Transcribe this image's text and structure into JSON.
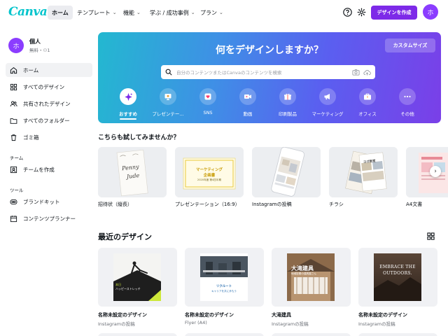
{
  "topnav": {
    "logo": "Canva",
    "items": [
      {
        "label": "ホーム",
        "active": true
      },
      {
        "label": "テンプレート",
        "chevron": "⌄"
      },
      {
        "label": "機能",
        "chevron": "⌄"
      },
      {
        "label": "学ぶ / 成功事例",
        "chevron": "⌄"
      },
      {
        "label": "プラン",
        "chevron": "⌄"
      }
    ],
    "help_icon": "help-circle-icon",
    "settings_icon": "gear-icon",
    "create_button": "デザインを作成",
    "avatar_initial": "ホ"
  },
  "sidebar": {
    "user": {
      "initial": "ホ",
      "name": "個人",
      "plan": "無料・",
      "members": "1"
    },
    "items": [
      {
        "label": "ホーム",
        "icon": "home-icon",
        "active": true
      },
      {
        "label": "すべてのデザイン",
        "icon": "grid-icon"
      },
      {
        "label": "共有されたデザイン",
        "icon": "people-icon"
      },
      {
        "label": "すべてのフォルダー",
        "icon": "folder-icon"
      },
      {
        "label": "ゴミ箱",
        "icon": "trash-icon"
      }
    ],
    "team_heading": "チーム",
    "team_items": [
      {
        "label": "チームを作成",
        "icon": "team-icon"
      }
    ],
    "tools_heading": "ツール",
    "tool_items": [
      {
        "label": "ブランドキット",
        "icon": "brand-icon"
      },
      {
        "label": "コンテンツプランナー",
        "icon": "calendar-icon"
      }
    ]
  },
  "hero": {
    "title": "何をデザインしますか？",
    "custom_size": "カスタムサイズ",
    "search_placeholder": "自分のコンテンツまたはCanvaのコンテンツを検索",
    "categories": [
      {
        "label": "おすすめ",
        "icon": "sparkle-icon",
        "active": true
      },
      {
        "label": "プレゼンテー...",
        "icon": "presentation-icon"
      },
      {
        "label": "SNS",
        "icon": "heart-icon"
      },
      {
        "label": "動画",
        "icon": "video-icon"
      },
      {
        "label": "印刷製品",
        "icon": "gift-icon"
      },
      {
        "label": "マーケティング",
        "icon": "megaphone-icon"
      },
      {
        "label": "オフィス",
        "icon": "briefcase-icon"
      },
      {
        "label": "その他",
        "icon": "more-icon"
      }
    ]
  },
  "suggestions": {
    "title": "こちらも試してみませんか？",
    "items": [
      {
        "label": "招待状（縦長）"
      },
      {
        "label": "プレゼンテーション（16:9）"
      },
      {
        "label": "Instagramの投稿"
      },
      {
        "label": "チラシ"
      },
      {
        "label": "A4文書"
      }
    ],
    "card_text": {
      "invite_line1": "Penny",
      "invite_line2": "Jude",
      "slide_line1": "マーケティング",
      "slide_line2": "企画書",
      "slide_line3": "2020年度 第4四半期",
      "flyer_title": "ヨガ教室"
    }
  },
  "recent": {
    "title": "最近のデザイン",
    "grid_icon": "grid-view-icon",
    "items": [
      {
        "name": "名称未設定のデザイン",
        "type": "Instagramの投稿",
        "thumb_text1": "本日",
        "thumb_text2": "ハッピーストレッチ"
      },
      {
        "name": "名称未設定のデザイン",
        "type": "Flyer (A4)",
        "thumb_text1": "リクルート",
        "thumb_text2": "キャリアを共に歩もう"
      },
      {
        "name": "大滝建具",
        "type": "Instagramの投稿",
        "thumb_text1": "大滝建具",
        "thumb_text2": "地域密着の建具屋さん"
      },
      {
        "name": "名称未設定のデザイン",
        "type": "Instagramの投稿",
        "thumb_text1": "EMBRACE THE",
        "thumb_text2": "OUTDOORS."
      }
    ]
  },
  "colors": {
    "brand_purple": "#7d2ae8",
    "canva_teal": "#00c4cc"
  }
}
